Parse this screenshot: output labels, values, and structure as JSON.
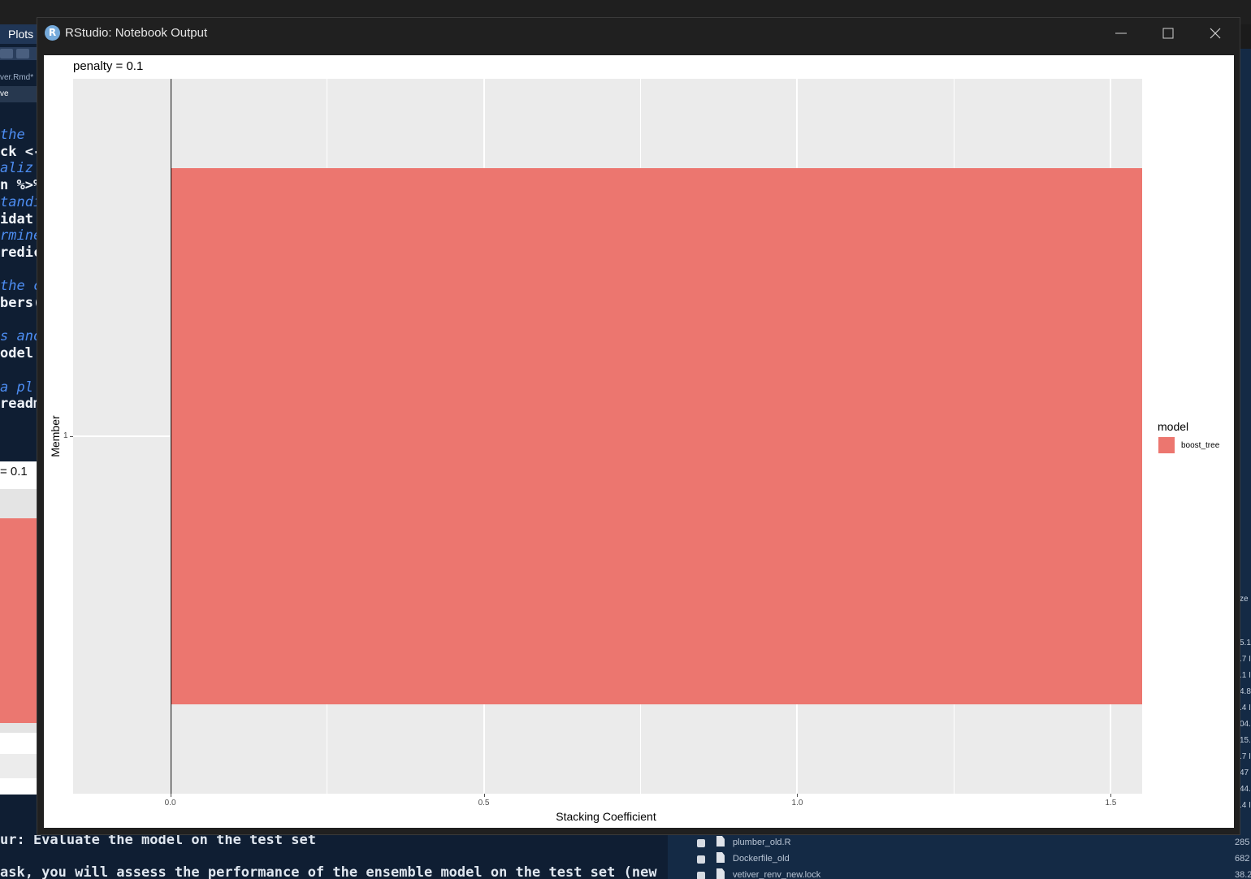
{
  "background_ide": {
    "plots_tab_label": "Plots",
    "file_tab_label": "ver.Rmd*",
    "save_label": "ve",
    "code_lines": [
      {
        "text": "the",
        "kind": "comment"
      },
      {
        "text": "ck <-",
        "kind": "plain"
      },
      {
        "text": "aliz",
        "kind": "comment"
      },
      {
        "text": "n %>%",
        "kind": "plain"
      },
      {
        "text": "tandi",
        "kind": "comment"
      },
      {
        "text": "idat",
        "kind": "plain"
      },
      {
        "text": "rmine",
        "kind": "comment"
      },
      {
        "text": "redic",
        "kind": "plain"
      },
      {
        "text": "",
        "kind": "plain"
      },
      {
        "text": "the c",
        "kind": "comment"
      },
      {
        "text": "bers(",
        "kind": "plain"
      },
      {
        "text": "",
        "kind": "plain"
      },
      {
        "text": "s ano",
        "kind": "comment"
      },
      {
        "text": "odel",
        "kind": "plain"
      },
      {
        "text": "",
        "kind": "plain"
      },
      {
        "text": "a pl",
        "kind": "comment"
      },
      {
        "text": "readm",
        "kind": "plain"
      }
    ],
    "mini_plot_title": "= 0.1",
    "bottom_lines": [
      "ur: Evaluate the model on the test set",
      "",
      "ask, you will assess the performance of the ensemble model on the test set (new"
    ],
    "files": [
      {
        "name": "plumber_old.R",
        "size": "285"
      },
      {
        "name": "Dockerfile_old",
        "size": "682"
      },
      {
        "name": "vetiver_renv_new.lock",
        "size": "38.2"
      }
    ],
    "right_strip_values": [
      "ze",
      "5.1",
      ".7 I",
      ".1 I",
      "4.8",
      ".4 I",
      "04.",
      "15.",
      ".7 I",
      "47",
      "44.",
      ".4 I"
    ]
  },
  "window": {
    "title": "RStudio: Notebook Output",
    "app_icon_letter": "R",
    "controls": [
      "minimize",
      "maximize",
      "close"
    ]
  },
  "plot": {
    "title": "penalty = 0.1",
    "xlabel": "Stacking Coefficient",
    "ylabel": "Member",
    "legend_title": "model",
    "legend_entries": [
      {
        "label": "boost_tree",
        "color": "#ec766f"
      }
    ]
  },
  "chart_data": {
    "type": "bar",
    "orientation": "horizontal",
    "title": "penalty = 0.1",
    "xlabel": "Stacking Coefficient",
    "ylabel": "Member",
    "categories": [
      "1"
    ],
    "values": [
      1.55
    ],
    "series": [
      {
        "name": "boost_tree",
        "values": [
          1.55
        ],
        "color": "#ec766f"
      }
    ],
    "x_ticks": [
      "0.0",
      "0.5",
      "1.0",
      "1.5"
    ],
    "x_tick_values": [
      0.0,
      0.5,
      1.0,
      1.5
    ],
    "y_ticks": [
      "1"
    ],
    "xlim": [
      -0.155,
      1.55
    ],
    "grid": true,
    "panel_background": "#ebebeb",
    "legend_position": "right"
  }
}
